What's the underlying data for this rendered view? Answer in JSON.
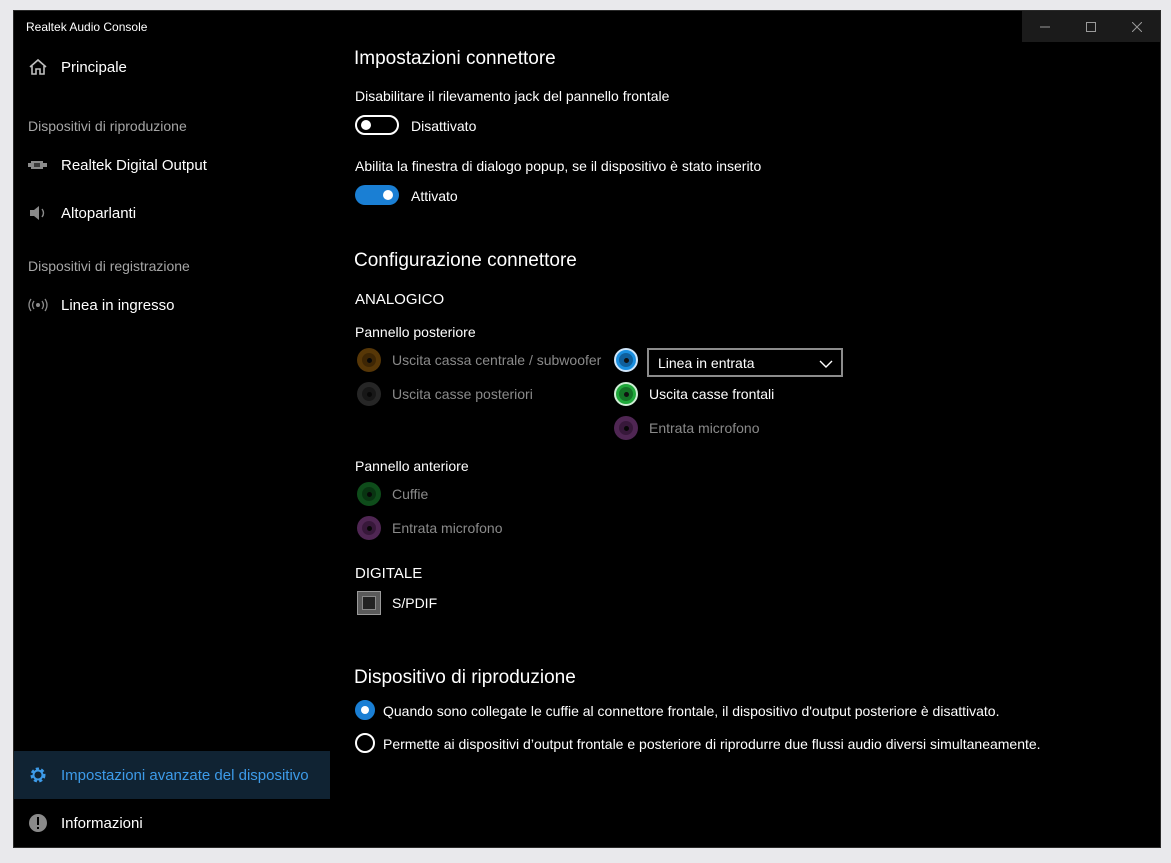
{
  "window": {
    "title": "Realtek Audio Console"
  },
  "sidebar": {
    "home": "Principale",
    "playback_section": "Dispositivi di riproduzione",
    "playback_items": [
      "Realtek Digital Output",
      "Altoparlanti"
    ],
    "recording_section": "Dispositivi di registrazione",
    "recording_items": [
      "Linea in ingresso"
    ],
    "advanced": "Impostazioni avanzate del dispositivo",
    "info": "Informazioni"
  },
  "connector_settings": {
    "title": "Impostazioni connettore",
    "jack_detection": {
      "label": "Disabilitare il rilevamento jack del pannello frontale",
      "state": "Disattivato",
      "on": false
    },
    "popup_dialog": {
      "label": "Abilita la finestra di dialogo popup, se il dispositivo è stato inserito",
      "state": "Attivato",
      "on": true
    }
  },
  "connector_config": {
    "title": "Configurazione connettore",
    "analog_label": "ANALOGICO",
    "rear_panel_label": "Pannello posteriore",
    "rear_left": [
      "Uscita cassa centrale / subwoofer",
      "Uscita casse posteriori"
    ],
    "rear_right_dropdown": "Linea in entrata",
    "rear_right": [
      "Uscita casse frontali",
      "Entrata microfono"
    ],
    "front_panel_label": "Pannello anteriore",
    "front": [
      "Cuffie",
      "Entrata microfono"
    ],
    "digital_label": "DIGITALE",
    "digital": "S/PDIF"
  },
  "playback_device": {
    "title": "Dispositivo di riproduzione",
    "options": [
      "Quando sono collegate le cuffie al connettore frontale, il dispositivo d'output posteriore è disattivato.",
      "Permette ai dispositivi d’output frontale e posteriore di riprodurre due flussi audio diversi simultaneamente."
    ],
    "selected_index": 0
  },
  "colors": {
    "accent": "#1a7fd4",
    "jack_orange": "#c07a10",
    "jack_black": "#444444",
    "jack_blue": "#1a8fe0",
    "jack_green": "#1fa83a",
    "jack_pink": "#b054b8"
  }
}
